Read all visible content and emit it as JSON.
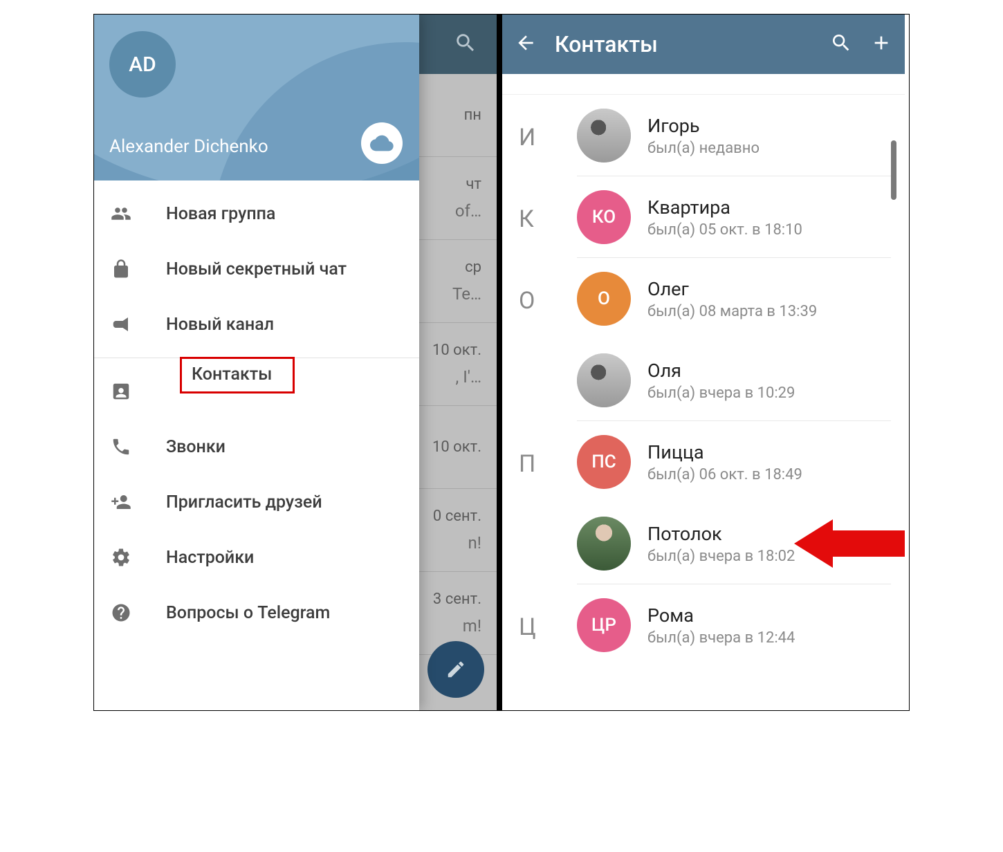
{
  "left": {
    "avatar_initials": "AD",
    "user_name": "Alexander Dichenko",
    "menu": {
      "new_group": "Новая группа",
      "secret_chat": "Новый секретный чат",
      "new_channel": "Новый канал",
      "contacts": "Контакты",
      "calls": "Звонки",
      "invite": "Пригласить друзей",
      "settings": "Настройки",
      "faq": "Вопросы о Telegram"
    },
    "chatbg": {
      "d0": "пн",
      "d1": "чт",
      "m1": "of…",
      "d2": "ср",
      "m2": "Te…",
      "d3": "10 окт.",
      "m3": ", I'…",
      "d4": "10 окт.",
      "d5": "0 сент.",
      "m5": "n!",
      "d6": "3 сент.",
      "m6": "m!"
    }
  },
  "right": {
    "title": "Контакты",
    "letters": {
      "i": "И",
      "k": "К",
      "o": "О",
      "p": "П",
      "c": "Ц"
    },
    "contacts": [
      {
        "name": "Игорь",
        "status": "был(а) недавно",
        "avatar": {
          "type": "img"
        }
      },
      {
        "name": "Квартира",
        "status": "был(а) 05 окт. в 18:10",
        "avatar": {
          "type": "initials",
          "text": "КО",
          "color": "#e65d8a"
        }
      },
      {
        "name": "Олег",
        "status": "был(а) 08 марта в 13:39",
        "avatar": {
          "type": "initials",
          "text": "О",
          "color": "#e78a3a"
        }
      },
      {
        "name": "Оля",
        "status": "был(а) вчера в 10:29",
        "avatar": {
          "type": "img"
        }
      },
      {
        "name": "Пицца",
        "status": "был(а) 06 окт. в 18:49",
        "avatar": {
          "type": "initials",
          "text": "ПС",
          "color": "#e0655c"
        }
      },
      {
        "name": "Потолок",
        "status": "был(а) вчера в 18:02",
        "avatar": {
          "type": "img-man"
        }
      },
      {
        "name": "Рома",
        "status": "был(а) вчера в 12:44",
        "avatar": {
          "type": "initials",
          "text": "ЦР",
          "color": "#e65d8a"
        }
      }
    ]
  }
}
